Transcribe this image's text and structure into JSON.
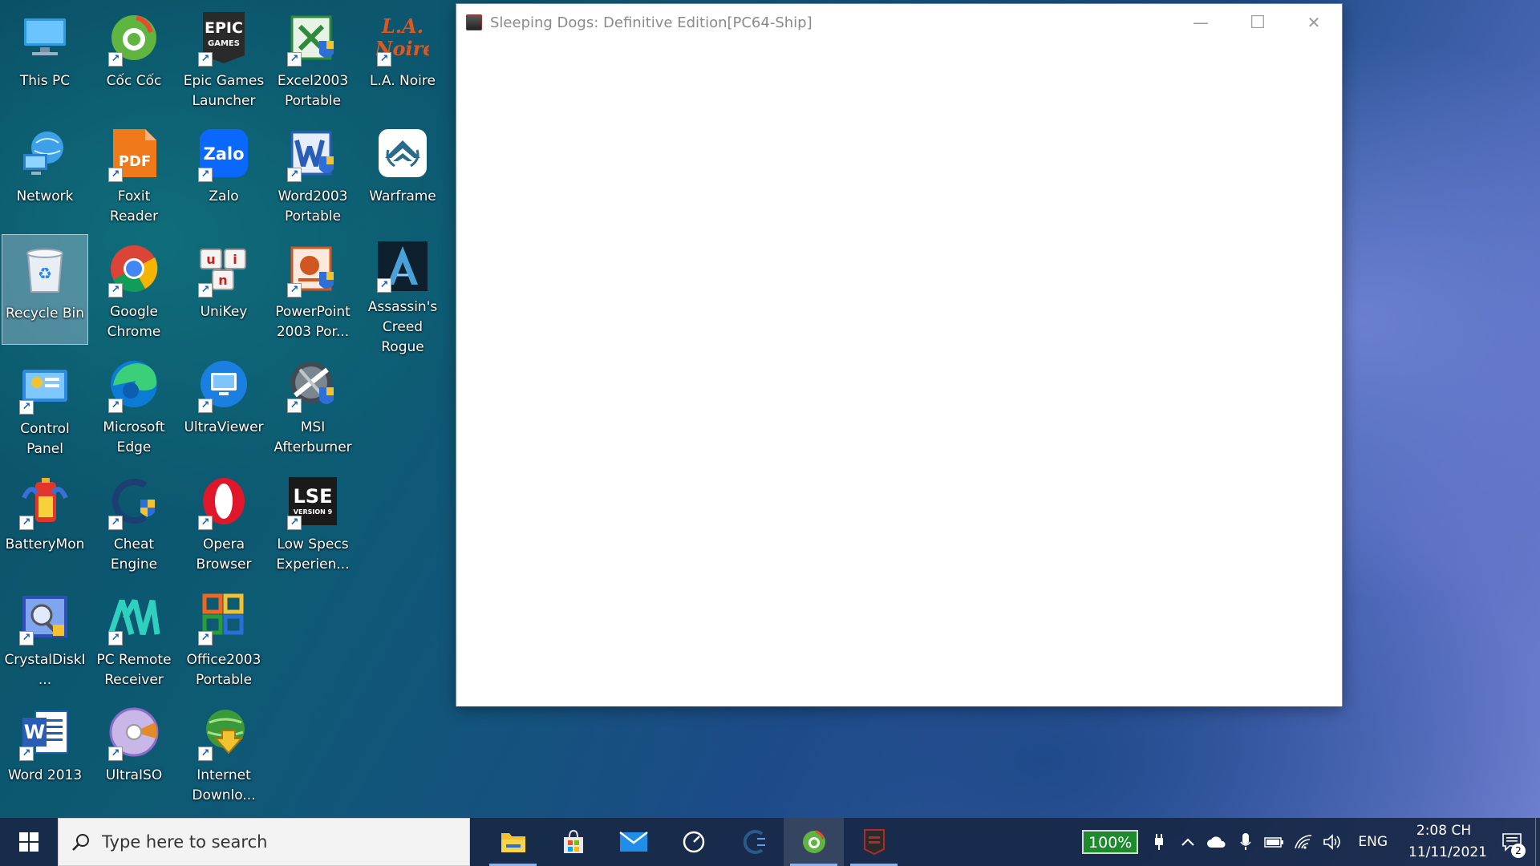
{
  "desktop": {
    "icons": [
      {
        "label": "This PC"
      },
      {
        "label": "Cốc Cốc"
      },
      {
        "label": "Epic Games Launcher"
      },
      {
        "label": "Excel2003 Portable"
      },
      {
        "label": "L.A. Noire"
      },
      {
        "label": "Network"
      },
      {
        "label": "Foxit Reader"
      },
      {
        "label": "Zalo"
      },
      {
        "label": "Word2003 Portable"
      },
      {
        "label": "Warframe"
      },
      {
        "label": "Recycle Bin"
      },
      {
        "label": "Google Chrome"
      },
      {
        "label": "UniKey"
      },
      {
        "label": "PowerPoint 2003 Por..."
      },
      {
        "label": "Assassin's Creed Rogue"
      },
      {
        "label": "Control Panel"
      },
      {
        "label": "Microsoft Edge"
      },
      {
        "label": "UltraViewer"
      },
      {
        "label": "MSI Afterburner"
      },
      {
        "label": "BatteryMon"
      },
      {
        "label": "Cheat Engine"
      },
      {
        "label": "Opera Browser"
      },
      {
        "label": "Low Specs Experien..."
      },
      {
        "label": "CrystalDiskI..."
      },
      {
        "label": "PC Remote Receiver"
      },
      {
        "label": "Office2003 Portable"
      },
      {
        "label": "Word 2013"
      },
      {
        "label": "UltraISO"
      },
      {
        "label": "Internet Downlo..."
      }
    ],
    "glyphs": {
      "epic": "EPIC",
      "epic_sub": "GAMES",
      "zalo": "Zalo",
      "pdf": "PDF",
      "lse": "LSE",
      "lse_sub": "VERSION 9",
      "word": "W",
      "la": "L.A.",
      "la_sub": "Noire",
      "unikey_u": "u",
      "unikey_i": "i",
      "unikey_n": "n"
    }
  },
  "window": {
    "title": "Sleeping Dogs: Definitive Edition[PC64-Ship]",
    "minimize": "—",
    "maximize": "☐",
    "close": "✕"
  },
  "taskbar": {
    "search_placeholder": "Type here to search",
    "apps": [
      {
        "icon": "file-explorer-icon",
        "running": true
      },
      {
        "icon": "microsoft-store-icon",
        "running": false
      },
      {
        "icon": "mail-icon",
        "running": false
      },
      {
        "icon": "msi-afterburner-icon",
        "running": false
      },
      {
        "icon": "cheat-engine-icon",
        "running": false
      },
      {
        "icon": "coc-coc-icon",
        "running": true
      },
      {
        "icon": "sleeping-dogs-icon",
        "running": true
      }
    ],
    "battery_percent": "100%",
    "language": "ENG",
    "time": "2:08 CH",
    "date": "11/11/2021",
    "notification_count": "2"
  }
}
